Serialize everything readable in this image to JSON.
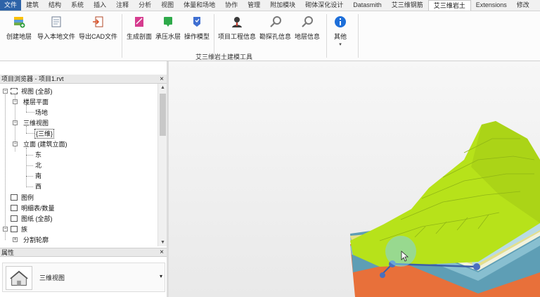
{
  "ribbon_tabs": [
    "文件",
    "建筑",
    "结构",
    "系统",
    "插入",
    "注释",
    "分析",
    "视图",
    "体量和场地",
    "协作",
    "管理",
    "附加模块",
    "砌体深化设计",
    "Datasmith",
    "艾三维钢筋",
    "艾三维岩土",
    "Extensions",
    "修改"
  ],
  "active_tab": "艾三维岩土",
  "ribbon": {
    "buttons": [
      "创建地层",
      "导入本地文件",
      "导出CAD文件",
      "生成剖面",
      "承压水层",
      "操作模型",
      "项目工程信息",
      "勘探孔信息",
      "地层信息",
      "其他"
    ],
    "group_label": "艾三维岩土建模工具"
  },
  "project_browser": {
    "title": "项目浏览器 - 项目1.rvt",
    "nodes": [
      "视图 (全部)",
      "楼层平面",
      "场地",
      "三维视图",
      "{三维}",
      "立面 (建筑立面)",
      "东",
      "北",
      "南",
      "西",
      "图例",
      "明细表/数量",
      "图纸 (全部)",
      "族",
      "分割轮廓"
    ]
  },
  "properties": {
    "title": "属性",
    "type_name": "三维视图"
  },
  "icons": {
    "close": "×",
    "tree_toggle_expanded": "−",
    "tree_toggle_collapsed": "+",
    "dropdown": "▾",
    "scroll_up": "▲",
    "scroll_down": "▼"
  }
}
